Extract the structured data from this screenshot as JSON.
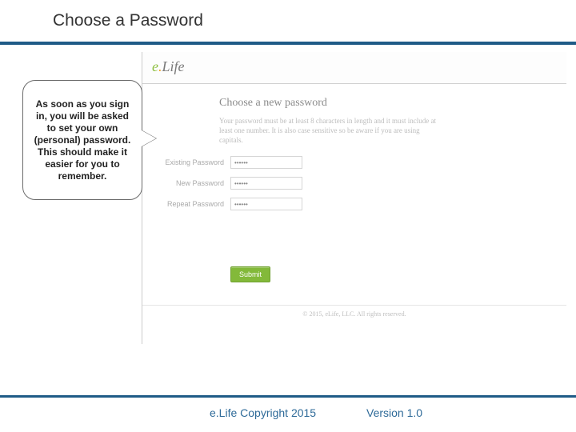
{
  "slide": {
    "title": "Choose a Password",
    "footer_left": "e.Life Copyright 2015",
    "footer_right": "Version 1.0"
  },
  "callout": {
    "text": "As soon as you sign in, you will be asked to set your own (personal) password. This should make it easier for you to remember."
  },
  "logo": {
    "brand_e": "e",
    "brand_dot": ".",
    "brand_rest": "Life"
  },
  "form": {
    "title": "Choose a new password",
    "hint": "Your password must be at least 8 characters in length and it must include at least one number. It is also case sensitive so be aware if you are using capitals.",
    "fields": {
      "existing": {
        "label": "Existing Password",
        "value": "••••••"
      },
      "new": {
        "label": "New Password",
        "value": "••••••"
      },
      "repeat": {
        "label": "Repeat Password",
        "value": "••••••"
      }
    },
    "submit_label": "Submit",
    "footer_text": "© 2015, eLife, LLC. All rights reserved."
  }
}
